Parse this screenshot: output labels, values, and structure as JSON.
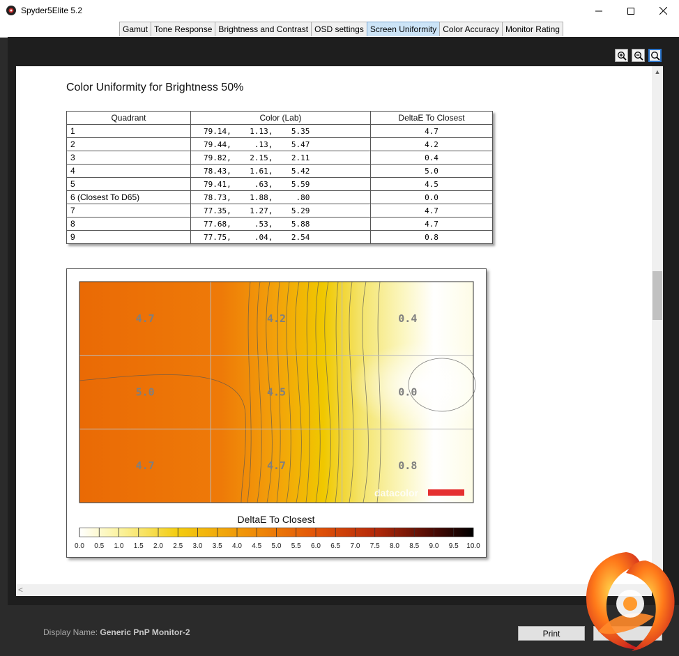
{
  "window": {
    "title": "Spyder5Elite 5.2"
  },
  "tabs": [
    {
      "label": "Gamut"
    },
    {
      "label": "Tone Response"
    },
    {
      "label": "Brightness and Contrast"
    },
    {
      "label": "OSD settings"
    },
    {
      "label": "Screen Uniformity",
      "active": true
    },
    {
      "label": "Color Accuracy"
    },
    {
      "label": "Monitor Rating"
    }
  ],
  "report": {
    "title": "Color Uniformity for Brightness 50%",
    "table": {
      "headers": [
        "Quadrant",
        "Color (Lab)",
        "DeltaE To Closest"
      ],
      "rows": [
        {
          "quadrant": "1",
          "lab": "79.14,    1.13,    5.35",
          "deltae": "4.7"
        },
        {
          "quadrant": "2",
          "lab": "79.44,     .13,    5.47",
          "deltae": "4.2"
        },
        {
          "quadrant": "3",
          "lab": "79.82,    2.15,    2.11",
          "deltae": "0.4"
        },
        {
          "quadrant": "4",
          "lab": "78.43,    1.61,    5.42",
          "deltae": "5.0"
        },
        {
          "quadrant": "5",
          "lab": "79.41,     .63,    5.59",
          "deltae": "4.5"
        },
        {
          "quadrant": "6 (Closest To D65)",
          "lab": "78.73,    1.88,     .80",
          "deltae": "0.0"
        },
        {
          "quadrant": "7",
          "lab": "77.35,    1.27,    5.29",
          "deltae": "4.7"
        },
        {
          "quadrant": "8",
          "lab": "77.68,     .53,    5.88",
          "deltae": "4.7"
        },
        {
          "quadrant": "9",
          "lab": "77.75,     .04,    2.54",
          "deltae": "0.8"
        }
      ]
    }
  },
  "chart_data": {
    "type": "heatmap",
    "grid": {
      "rows": 3,
      "cols": 3
    },
    "cells": [
      [
        "4.7",
        "4.2",
        "0.4"
      ],
      [
        "5.0",
        "4.5",
        "0.0"
      ],
      [
        "4.7",
        "4.7",
        "0.8"
      ]
    ],
    "scale_title": "DeltaE To Closest",
    "scale_ticks": [
      "0.0",
      "0.5",
      "1.0",
      "1.5",
      "2.0",
      "2.5",
      "3.0",
      "3.5",
      "4.0",
      "4.5",
      "5.0",
      "5.5",
      "6.0",
      "6.5",
      "7.0",
      "7.5",
      "8.0",
      "8.5",
      "9.0",
      "9.5",
      "10.0"
    ],
    "watermark": "datacolor",
    "colors": {
      "low": "#ffffff",
      "mid": "#f2c400",
      "high": "#e85d00",
      "max": "#000000"
    }
  },
  "footer": {
    "display_name_label": "Display Name:",
    "display_name_value": "Generic PnP Monitor-2",
    "print_label": "Print"
  },
  "icons": [
    "zoom-in-icon",
    "zoom-out-icon",
    "zoom-fit-icon"
  ]
}
